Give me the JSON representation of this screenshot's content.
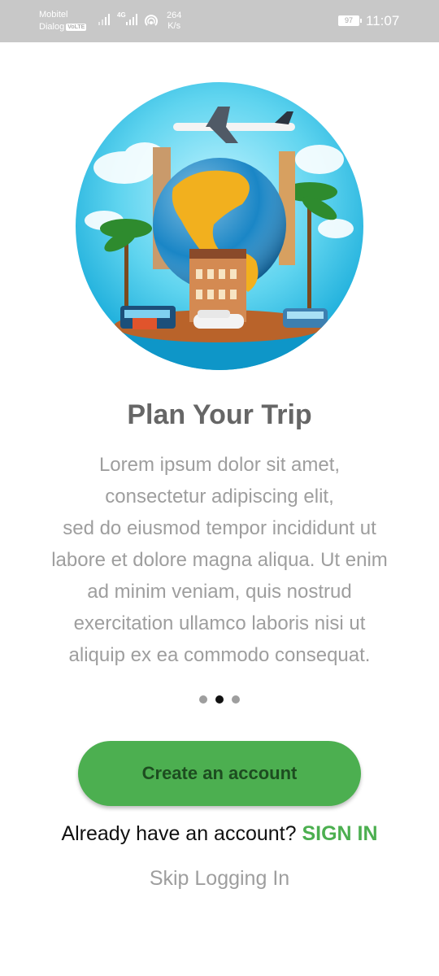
{
  "status_bar": {
    "carrier_1": "Mobitel",
    "carrier_2": "Dialog",
    "volte_badge": "VoLTE",
    "network_type": "4G",
    "speed_value": "264",
    "speed_unit": "K/s",
    "battery_level": "97",
    "time": "11:07"
  },
  "hero": {
    "icon": "travel-globe-illustration"
  },
  "onboarding": {
    "title": "Plan Your Trip",
    "description_lines": [
      "Lorem ipsum dolor sit amet,",
      "consectetur adipiscing elit,",
      "sed do eiusmod tempor incididunt ut",
      "labore et dolore magna aliqua. Ut enim",
      "ad minim veniam, quis nostrud",
      "exercitation ullamco laboris nisi ut",
      "aliquip ex ea commodo consequat."
    ],
    "page_count": 3,
    "active_page": 2
  },
  "actions": {
    "create_account_label": "Create an account",
    "already_have_account_text": "Already have an account?",
    "sign_in_label": "SIGN IN",
    "skip_label": "Skip Logging In"
  },
  "colors": {
    "accent_green": "#4caf50",
    "status_bar_bg": "#c8c8c8",
    "title_gray": "#666666",
    "body_gray": "#9e9e9e"
  }
}
